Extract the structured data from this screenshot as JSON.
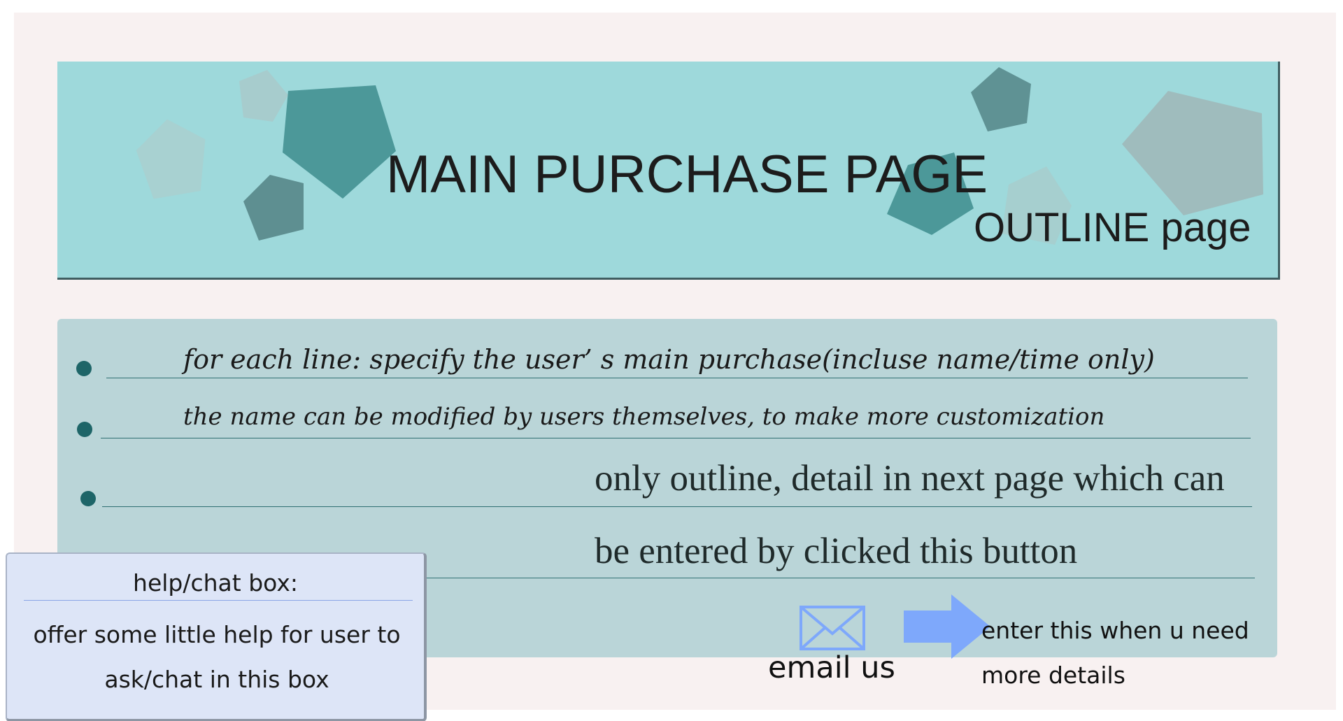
{
  "header": {
    "title": "MAIN PURCHASE PAGE",
    "subtitle": "OUTLINE page",
    "background_color": "#9ed9db"
  },
  "content": {
    "background_color": "#bad5d8",
    "lines": [
      "for each line: specify the user’  s main purchase(incluse name/time only)",
      "the name can be modified by users themselves, to make more customization",
      "only outline, detail in next page which can",
      "be entered by clicked this button"
    ]
  },
  "actions": {
    "email_icon": "envelope-icon",
    "email_label": "email us",
    "arrow_icon": "right-arrow-icon",
    "more_text": "enter this when u need more details",
    "accent_color": "#7ea8fb"
  },
  "help_box": {
    "title": "help/chat box:",
    "body": "offer some little help for user to ask/chat in this box"
  }
}
